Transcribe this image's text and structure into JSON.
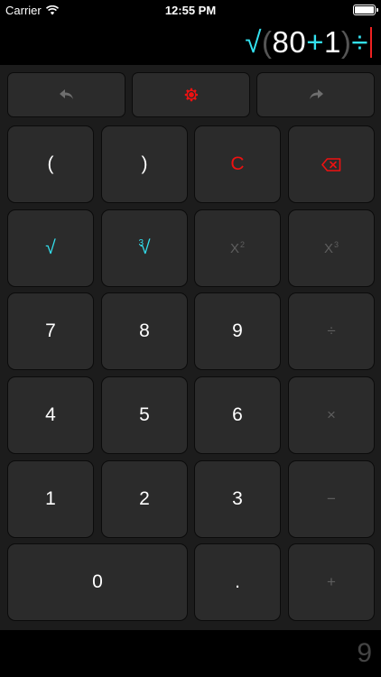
{
  "status": {
    "carrier": "Carrier",
    "time": "12:55 PM"
  },
  "display": {
    "sqrt_symbol": "√",
    "open_paren": "(",
    "num1": "80",
    "plus": "+",
    "num2": "1",
    "close_paren": ")",
    "divide": "÷"
  },
  "keys": {
    "open_paren": "(",
    "close_paren": ")",
    "clear": "C",
    "sqrt": "√",
    "cbrt_index": "3",
    "cbrt_sym": "√",
    "square_base": "X",
    "square_exp": "2",
    "cube_base": "X",
    "cube_exp": "3",
    "seven": "7",
    "eight": "8",
    "nine": "9",
    "divide": "÷",
    "four": "4",
    "five": "5",
    "six": "6",
    "multiply": "×",
    "one": "1",
    "two": "2",
    "three": "3",
    "minus": "−",
    "zero": "0",
    "decimal": ".",
    "plus": "+"
  },
  "result": {
    "value": "9"
  },
  "colors": {
    "accent_cyan": "#33e0ee",
    "accent_red": "#ee1111",
    "key_bg": "#2b2b2b",
    "pad_bg": "#1c1c1c"
  },
  "icons": {
    "undo": "undo-arrow-icon",
    "settings": "gear-icon",
    "redo": "redo-arrow-icon",
    "backspace": "backspace-icon",
    "wifi": "wifi-icon",
    "battery": "battery-icon"
  }
}
